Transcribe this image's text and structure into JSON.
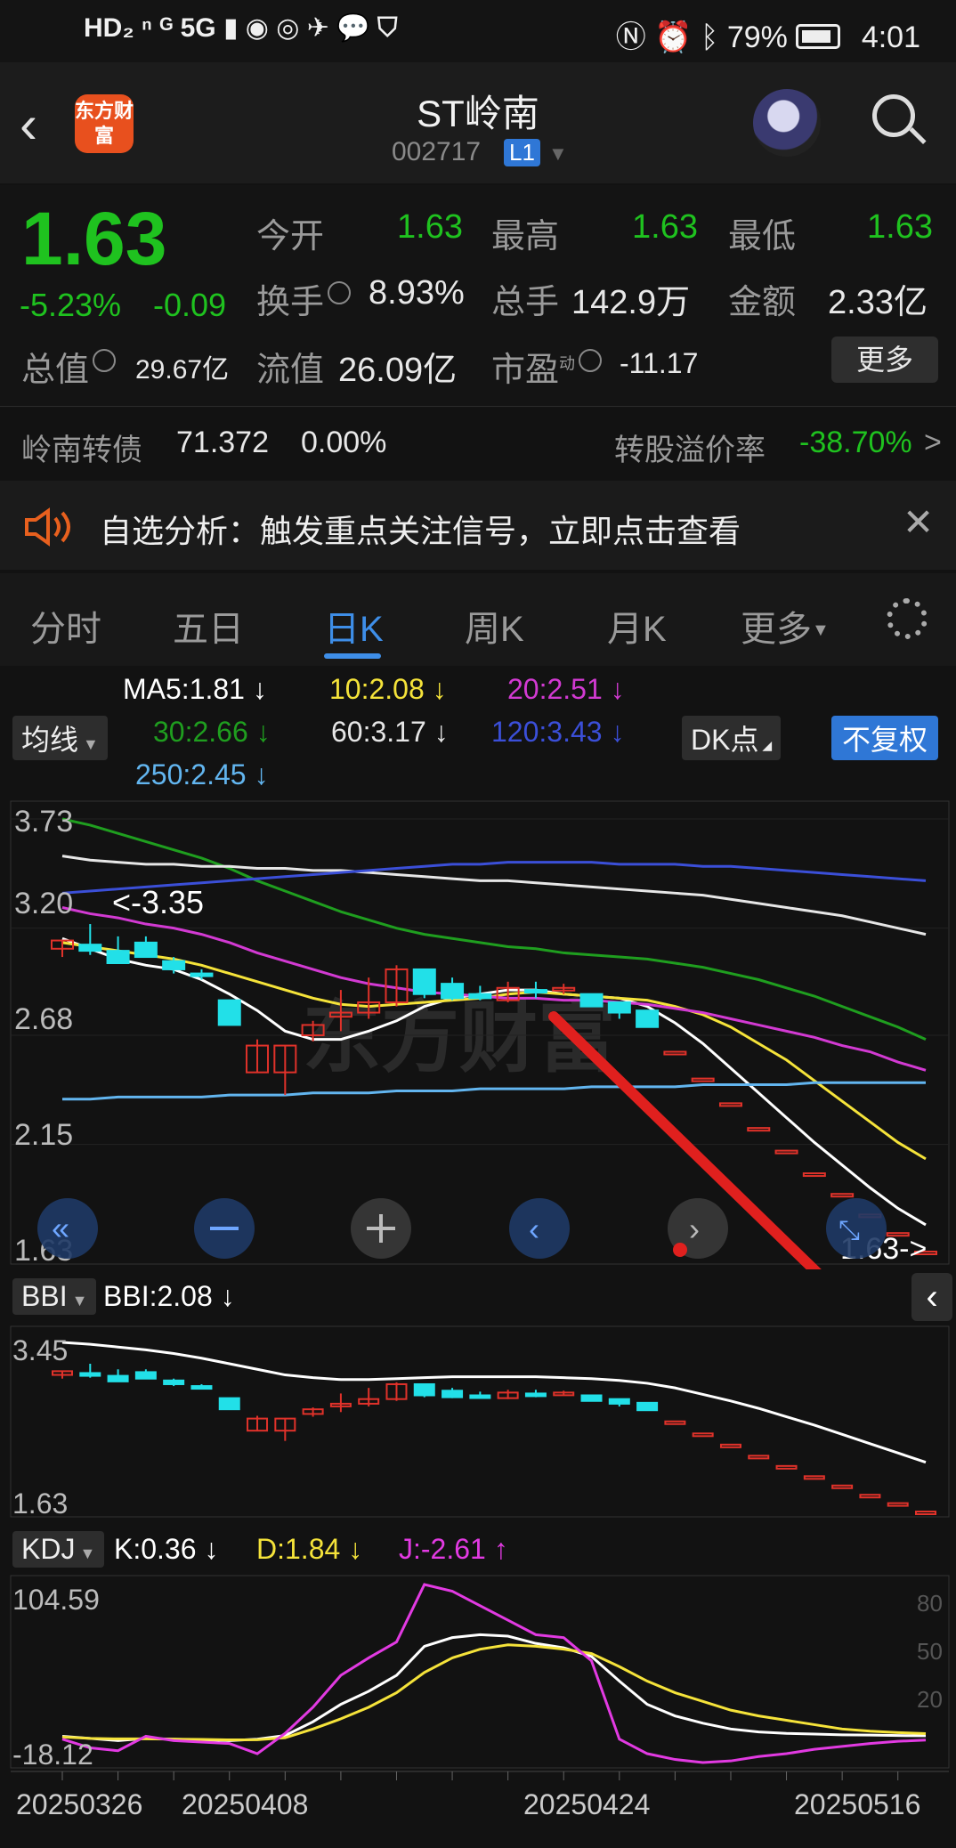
{
  "status_bar": {
    "left_icons": "HD₂ ⁿ ᴳ 5G ▮ ◉ ◎ ✈ 💬 ⛉",
    "battery_pct": "79%",
    "time": "4:01"
  },
  "header": {
    "back_icon": "chevron-left",
    "logo_text": "东方财富",
    "stock_name": "ST岭南",
    "stock_code": "002717",
    "level_badge": "L1"
  },
  "quote": {
    "price": "1.63",
    "change_pct": "-5.23%",
    "change_abs": "-0.09",
    "open_label": "今开",
    "open": "1.63",
    "high_label": "最高",
    "high": "1.63",
    "low_label": "最低",
    "low": "1.63",
    "turnover_label": "换手",
    "turnover": "8.93%",
    "volume_label": "总手",
    "volume": "142.9万",
    "amount_label": "金额",
    "amount": "2.33亿",
    "mktcap_label": "总值",
    "mktcap": "29.67亿",
    "float_label": "流值",
    "float_cap": "26.09亿",
    "pe_label": "市盈",
    "pe_sup": "动",
    "pe": "-11.17",
    "more_label": "更多"
  },
  "bond": {
    "name": "岭南转债",
    "price": "71.372",
    "change": "0.00%",
    "premium_label": "转股溢价率",
    "premium": "-38.70%",
    "arrow": ">"
  },
  "alert": {
    "text": "自选分析：触发重点关注信号，立即点击查看",
    "close": "✕"
  },
  "tabs": [
    {
      "label": "分时"
    },
    {
      "label": "五日"
    },
    {
      "label": "日K",
      "active": true
    },
    {
      "label": "周K"
    },
    {
      "label": "月K"
    },
    {
      "label": "更多"
    }
  ],
  "ma_panel": {
    "selector": "均线",
    "ma5": "MA5:1.81 ↓",
    "ma10": "10:2.08 ↓",
    "ma20": "20:2.51 ↓",
    "ma30": "30:2.66 ↓",
    "ma60": "60:3.17 ↓",
    "ma120": "120:3.43 ↓",
    "ma250": "250:2.45 ↓",
    "dk_label": "DK点",
    "fq_label": "不复权",
    "colors": {
      "ma5": "#ffffff",
      "ma10": "#f5e33a",
      "ma20": "#d23ad2",
      "ma30": "#1f9e1f",
      "ma60": "#e6e6e6",
      "ma120": "#3b4fd8",
      "ma250": "#62b5ef"
    }
  },
  "main_chart": {
    "y_labels": [
      "3.73",
      "3.20",
      "2.68",
      "2.15",
      "1.63"
    ],
    "annotation_high": "<-3.35",
    "annotation_last": "1.63->",
    "watermark": "东方财富"
  },
  "bbi_panel": {
    "selector": "BBI",
    "value": "BBI:2.08 ↓",
    "y_labels": [
      "3.45",
      "1.63"
    ]
  },
  "kdj_panel": {
    "selector": "KDJ",
    "k": "K:0.36 ↓",
    "d": "D:1.84 ↓",
    "j": "J:-2.61 ↑",
    "y_labels": [
      "104.59",
      "-18.12"
    ],
    "levels": [
      "80",
      "50",
      "20"
    ]
  },
  "x_axis": {
    "dates": [
      "20250326",
      "20250408",
      "20250424",
      "20250516"
    ]
  },
  "chart_data": {
    "type": "candlestick",
    "title": "",
    "ylim": [
      1.63,
      3.73
    ],
    "candles": [
      {
        "o": 3.1,
        "h": 3.13,
        "l": 3.06,
        "c": 3.14
      },
      {
        "o": 3.12,
        "h": 3.22,
        "l": 3.07,
        "c": 3.09
      },
      {
        "o": 3.09,
        "h": 3.16,
        "l": 3.04,
        "c": 3.03
      },
      {
        "o": 3.13,
        "h": 3.16,
        "l": 3.07,
        "c": 3.06
      },
      {
        "o": 3.04,
        "h": 3.06,
        "l": 2.98,
        "c": 3.0
      },
      {
        "o": 2.98,
        "h": 3.0,
        "l": 2.95,
        "c": 2.97
      },
      {
        "o": 2.85,
        "h": 2.85,
        "l": 2.73,
        "c": 2.73
      },
      {
        "o": 2.5,
        "h": 2.66,
        "l": 2.5,
        "c": 2.63
      },
      {
        "o": 2.5,
        "h": 2.63,
        "l": 2.39,
        "c": 2.63
      },
      {
        "o": 2.68,
        "h": 2.75,
        "l": 2.65,
        "c": 2.73
      },
      {
        "o": 2.77,
        "h": 2.9,
        "l": 2.7,
        "c": 2.79
      },
      {
        "o": 2.79,
        "h": 2.96,
        "l": 2.76,
        "c": 2.84
      },
      {
        "o": 2.84,
        "h": 3.02,
        "l": 2.82,
        "c": 3.0
      },
      {
        "o": 3.0,
        "h": 3.0,
        "l": 2.86,
        "c": 2.88
      },
      {
        "o": 2.93,
        "h": 2.96,
        "l": 2.85,
        "c": 2.86
      },
      {
        "o": 2.88,
        "h": 2.92,
        "l": 2.85,
        "c": 2.86
      },
      {
        "o": 2.85,
        "h": 2.94,
        "l": 2.84,
        "c": 2.91
      },
      {
        "o": 2.9,
        "h": 2.94,
        "l": 2.86,
        "c": 2.89
      },
      {
        "o": 2.9,
        "h": 2.93,
        "l": 2.88,
        "c": 2.91
      },
      {
        "o": 2.88,
        "h": 2.86,
        "l": 2.82,
        "c": 2.82
      },
      {
        "o": 2.84,
        "h": 2.84,
        "l": 2.76,
        "c": 2.79
      },
      {
        "o": 2.8,
        "h": 2.8,
        "l": 2.72,
        "c": 2.72
      },
      {
        "o": 2.6,
        "h": 2.6,
        "l": 2.6,
        "c": 2.6
      },
      {
        "o": 2.47,
        "h": 2.47,
        "l": 2.47,
        "c": 2.47
      },
      {
        "o": 2.35,
        "h": 2.35,
        "l": 2.35,
        "c": 2.35
      },
      {
        "o": 2.23,
        "h": 2.23,
        "l": 2.23,
        "c": 2.23
      },
      {
        "o": 2.12,
        "h": 2.12,
        "l": 2.12,
        "c": 2.12
      },
      {
        "o": 2.01,
        "h": 2.01,
        "l": 2.01,
        "c": 2.01
      },
      {
        "o": 1.91,
        "h": 1.91,
        "l": 1.91,
        "c": 1.91
      },
      {
        "o": 1.81,
        "h": 1.81,
        "l": 1.81,
        "c": 1.81
      },
      {
        "o": 1.72,
        "h": 1.72,
        "l": 1.72,
        "c": 1.72
      },
      {
        "o": 1.63,
        "h": 1.63,
        "l": 1.63,
        "c": 1.63
      }
    ],
    "series": [
      {
        "name": "MA5",
        "color": "#ffffff",
        "values": [
          3.15,
          3.1,
          3.05,
          3.02,
          3.0,
          2.95,
          2.88,
          2.8,
          2.7,
          2.66,
          2.66,
          2.7,
          2.75,
          2.82,
          2.86,
          2.88,
          2.9,
          2.9,
          2.88,
          2.87,
          2.86,
          2.82,
          2.74,
          2.64,
          2.52,
          2.4,
          2.28,
          2.16,
          2.05,
          1.94,
          1.84,
          1.76
        ]
      },
      {
        "name": "10",
        "color": "#f5e33a",
        "values": [
          3.13,
          3.11,
          3.09,
          3.07,
          3.05,
          3.02,
          2.98,
          2.94,
          2.9,
          2.86,
          2.83,
          2.82,
          2.83,
          2.84,
          2.85,
          2.86,
          2.88,
          2.89,
          2.88,
          2.87,
          2.86,
          2.85,
          2.82,
          2.78,
          2.72,
          2.64,
          2.56,
          2.46,
          2.36,
          2.26,
          2.16,
          2.08
        ]
      },
      {
        "name": "20",
        "color": "#d23ad2",
        "values": [
          3.3,
          3.27,
          3.25,
          3.22,
          3.2,
          3.17,
          3.13,
          3.08,
          3.04,
          3.0,
          2.96,
          2.93,
          2.91,
          2.89,
          2.88,
          2.87,
          2.86,
          2.86,
          2.85,
          2.85,
          2.84,
          2.83,
          2.81,
          2.79,
          2.76,
          2.73,
          2.7,
          2.67,
          2.63,
          2.6,
          2.55,
          2.51
        ]
      },
      {
        "name": "30",
        "color": "#1f9e1f",
        "values": [
          3.73,
          3.7,
          3.66,
          3.62,
          3.58,
          3.54,
          3.49,
          3.43,
          3.38,
          3.33,
          3.28,
          3.24,
          3.2,
          3.17,
          3.15,
          3.13,
          3.11,
          3.1,
          3.08,
          3.07,
          3.06,
          3.05,
          3.03,
          3.01,
          2.98,
          2.95,
          2.91,
          2.87,
          2.82,
          2.77,
          2.72,
          2.66
        ]
      },
      {
        "name": "60",
        "color": "#e6e6e6",
        "values": [
          3.55,
          3.53,
          3.52,
          3.51,
          3.51,
          3.5,
          3.5,
          3.49,
          3.49,
          3.48,
          3.48,
          3.47,
          3.46,
          3.45,
          3.44,
          3.43,
          3.43,
          3.42,
          3.41,
          3.4,
          3.39,
          3.38,
          3.37,
          3.36,
          3.34,
          3.32,
          3.3,
          3.28,
          3.26,
          3.23,
          3.2,
          3.17
        ]
      },
      {
        "name": "120",
        "color": "#3b4fd8",
        "values": [
          3.37,
          3.38,
          3.39,
          3.4,
          3.41,
          3.42,
          3.43,
          3.44,
          3.45,
          3.46,
          3.47,
          3.48,
          3.49,
          3.5,
          3.51,
          3.51,
          3.52,
          3.52,
          3.52,
          3.52,
          3.51,
          3.51,
          3.51,
          3.5,
          3.5,
          3.49,
          3.48,
          3.47,
          3.46,
          3.45,
          3.44,
          3.43
        ]
      },
      {
        "name": "250",
        "color": "#62b5ef",
        "values": [
          2.37,
          2.37,
          2.38,
          2.38,
          2.38,
          2.38,
          2.39,
          2.39,
          2.39,
          2.4,
          2.4,
          2.4,
          2.41,
          2.41,
          2.41,
          2.42,
          2.42,
          2.42,
          2.42,
          2.43,
          2.43,
          2.43,
          2.43,
          2.44,
          2.44,
          2.44,
          2.44,
          2.45,
          2.45,
          2.45,
          2.45,
          2.45
        ]
      }
    ],
    "bbi": [
      3.45,
      3.43,
      3.4,
      3.37,
      3.33,
      3.28,
      3.22,
      3.16,
      3.1,
      3.07,
      3.05,
      3.05,
      3.06,
      3.07,
      3.08,
      3.08,
      3.08,
      3.08,
      3.07,
      3.06,
      3.04,
      3.01,
      2.96,
      2.89,
      2.82,
      2.74,
      2.65,
      2.56,
      2.46,
      2.36,
      2.26,
      2.16
    ],
    "kdj": {
      "k": [
        0.0,
        -1.5,
        -3.0,
        -1.5,
        -2.0,
        -2.5,
        -3.0,
        -2.0,
        0.5,
        10.0,
        22.0,
        31.0,
        42.0,
        62.0,
        68.0,
        70.0,
        69.0,
        64.0,
        61.0,
        55.0,
        38.0,
        22.0,
        14.0,
        9.0,
        5.0,
        3.0,
        2.0,
        1.5,
        1.0,
        0.8,
        0.5,
        0.36
      ],
      "d": [
        -0.5,
        -1.5,
        -1.8,
        -1.8,
        -2.0,
        -2.2,
        -2.5,
        -2.4,
        -1.0,
        5.0,
        12.0,
        20.0,
        30.0,
        44.0,
        54.0,
        60.0,
        63.0,
        62.0,
        60.0,
        57.0,
        48.0,
        38.0,
        30.0,
        24.0,
        18.0,
        14.0,
        11.0,
        8.0,
        5.0,
        3.5,
        2.5,
        1.84
      ],
      "j": [
        -2.0,
        -8.0,
        -10.0,
        0.0,
        -3.0,
        -4.0,
        -5.0,
        -12.0,
        2.0,
        20.0,
        42.0,
        54.0,
        65.0,
        104.59,
        100.0,
        90.0,
        80.0,
        70.0,
        68.0,
        52.0,
        -2.0,
        -12.0,
        -16.0,
        -18.12,
        -17.0,
        -14.0,
        -12.0,
        -9.0,
        -7.0,
        -5.0,
        -3.5,
        -2.61
      ]
    }
  }
}
